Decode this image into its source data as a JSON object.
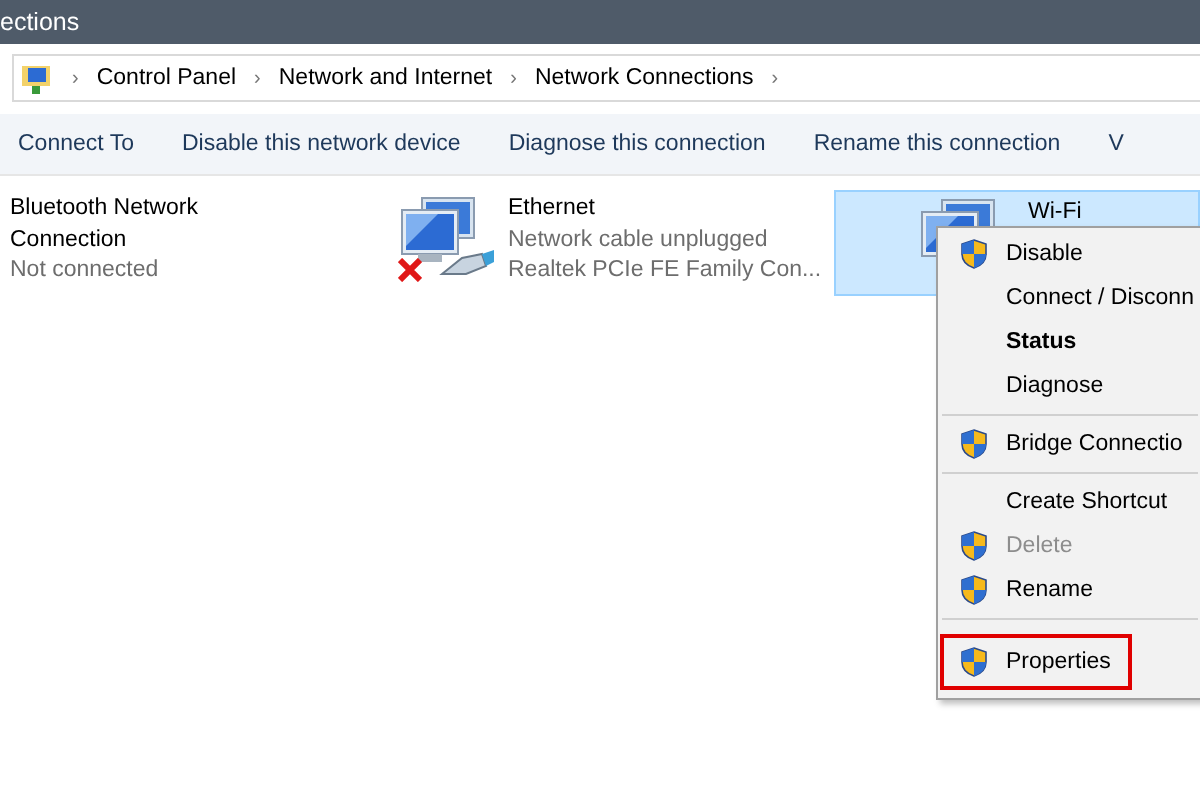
{
  "window": {
    "title": "ections"
  },
  "address_bar": {
    "crumbs": [
      {
        "chevron": "›",
        "label": "Control Panel"
      },
      {
        "chevron": "›",
        "label": "Network and Internet"
      },
      {
        "chevron": "›",
        "label": "Network Connections"
      }
    ],
    "end_chevron": "›"
  },
  "toolbar": [
    "Connect To",
    "Disable this network device",
    "Diagnose this connection",
    "Rename this connection",
    "V"
  ],
  "connections": [
    {
      "name": "Bluetooth Network Connection",
      "lines": [
        "Not connected"
      ],
      "icon": false,
      "unplugged": false,
      "selected": false
    },
    {
      "name": "Ethernet",
      "lines": [
        "Network cable unplugged",
        "Realtek PCIe FE Family Con..."
      ],
      "icon": true,
      "unplugged": true,
      "selected": false
    },
    {
      "name": "Wi-Fi",
      "icon": true,
      "unplugged": false,
      "selected": true
    }
  ],
  "context_menu": [
    {
      "kind": "shield_item",
      "label": "Disable",
      "default": false,
      "disabled": false,
      "highlighted": false
    },
    {
      "kind": "item",
      "label": "Connect / Disconn",
      "default": false,
      "disabled": false,
      "highlighted": false
    },
    {
      "kind": "item",
      "label": "Status",
      "default": true,
      "disabled": false,
      "highlighted": false
    },
    {
      "kind": "item",
      "label": "Diagnose",
      "default": false,
      "disabled": false,
      "highlighted": false
    },
    {
      "kind": "separator"
    },
    {
      "kind": "shield_item",
      "label": "Bridge Connectio",
      "default": false,
      "disabled": false,
      "highlighted": false
    },
    {
      "kind": "separator"
    },
    {
      "kind": "item",
      "label": "Create Shortcut",
      "default": false,
      "disabled": false,
      "highlighted": false
    },
    {
      "kind": "shield_item",
      "label": "Delete",
      "default": false,
      "disabled": true,
      "highlighted": false
    },
    {
      "kind": "shield_item",
      "label": "Rename",
      "default": false,
      "disabled": false,
      "highlighted": false
    },
    {
      "kind": "separator"
    },
    {
      "kind": "shield_item",
      "label": "Properties",
      "default": false,
      "disabled": false,
      "highlighted": true
    }
  ]
}
